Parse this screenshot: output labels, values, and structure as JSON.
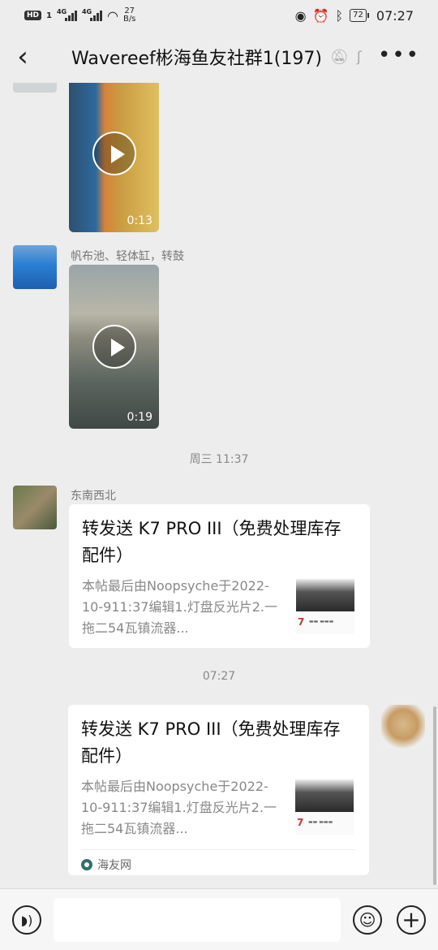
{
  "status_bar": {
    "hd_label": "HD",
    "sim1": "1",
    "net1": "4G",
    "net2": "4G",
    "speed_value": "27",
    "speed_unit": "B/s",
    "battery": "72",
    "time": "07:27"
  },
  "nav": {
    "back_icon": "chevron-left-icon",
    "title": "Wavereef彬海鱼友社群1(197)",
    "more_icon": "ellipsis-icon"
  },
  "messages": {
    "video1": {
      "duration": "0:13"
    },
    "msg2": {
      "sender": "帆布池、轻体缸，转鼓",
      "duration": "0:19"
    },
    "time1": "周三 11:37",
    "msg3": {
      "sender": "东南西北",
      "title": "转发送 K7 PRO III（免费处理库存配件）",
      "desc": "本帖最后由Noopsyche于2022-10-911:37编辑1.灯盘反光片2.一拖二54瓦镇流器..."
    },
    "time2": "07:27",
    "msg4": {
      "title": "转发送 K7 PRO III（免费处理库存配件）",
      "desc": "本帖最后由Noopsyche于2022-10-911:37编辑1.灯盘反光片2.一拖二54瓦镇流器...",
      "source": "海友网"
    },
    "thumb_seven": "7"
  },
  "input_bar": {
    "voice_icon": "voice-icon",
    "emoji_icon": "emoji-icon",
    "plus_icon": "plus-icon"
  }
}
